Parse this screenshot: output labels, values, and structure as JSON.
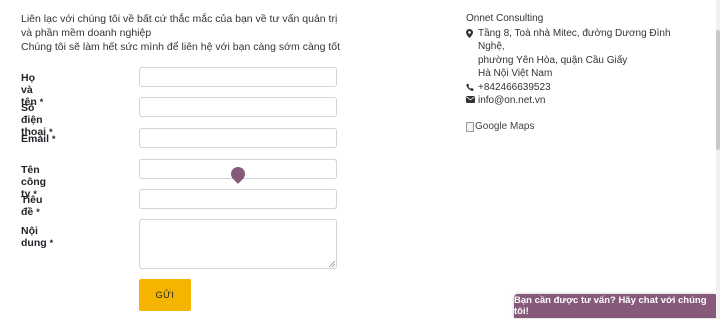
{
  "intro": {
    "line1": "Liên lạc với chúng tôi về bất cứ thắc mắc của bạn về tư vấn quản trị và phần mềm doanh nghiệp",
    "line2": "Chúng tôi sẽ làm hết sức mình để liên hệ với bạn càng sớm càng tốt"
  },
  "form": {
    "fields": [
      {
        "label": "Họ và tên",
        "required": "*"
      },
      {
        "label": "Số điện thoại",
        "required": "*"
      },
      {
        "label": "Email",
        "required": "*"
      },
      {
        "label": "Tên công ty",
        "required": "*"
      },
      {
        "label": "Tiêu đề",
        "required": "*"
      },
      {
        "label": "Nội dung",
        "required": "*"
      }
    ],
    "submit_label": "GỬI"
  },
  "company": {
    "name": "Onnet Consulting",
    "address_line1": "Tầng 8, Toà nhà Mitec, đường Dương Đình",
    "address_line2": "Nghệ,",
    "address_line3": "phường Yên Hòa, quận Cầu Giấy",
    "address_line4": "Hà Nội Việt Nam",
    "phone": "+842466639523",
    "email": "info@on.net.vn",
    "map_alt": "Google Maps"
  },
  "chat": {
    "label": "Bạn cần được tư vấn? Hãy chat với chúng tôi!"
  },
  "colors": {
    "accent": "#875a7b",
    "button": "#f4b400"
  },
  "icons": [
    "map-marker-icon",
    "phone-icon",
    "envelope-icon"
  ]
}
